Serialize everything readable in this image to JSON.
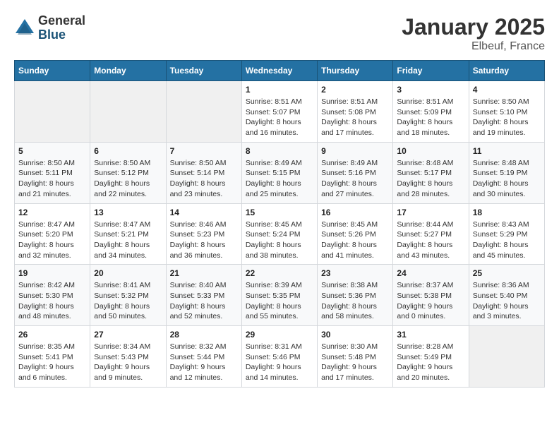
{
  "logo": {
    "general": "General",
    "blue": "Blue"
  },
  "title": "January 2025",
  "subtitle": "Elbeuf, France",
  "header_days": [
    "Sunday",
    "Monday",
    "Tuesday",
    "Wednesday",
    "Thursday",
    "Friday",
    "Saturday"
  ],
  "weeks": [
    [
      {
        "day": "",
        "info": ""
      },
      {
        "day": "",
        "info": ""
      },
      {
        "day": "",
        "info": ""
      },
      {
        "day": "1",
        "info": "Sunrise: 8:51 AM\nSunset: 5:07 PM\nDaylight: 8 hours\nand 16 minutes."
      },
      {
        "day": "2",
        "info": "Sunrise: 8:51 AM\nSunset: 5:08 PM\nDaylight: 8 hours\nand 17 minutes."
      },
      {
        "day": "3",
        "info": "Sunrise: 8:51 AM\nSunset: 5:09 PM\nDaylight: 8 hours\nand 18 minutes."
      },
      {
        "day": "4",
        "info": "Sunrise: 8:50 AM\nSunset: 5:10 PM\nDaylight: 8 hours\nand 19 minutes."
      }
    ],
    [
      {
        "day": "5",
        "info": "Sunrise: 8:50 AM\nSunset: 5:11 PM\nDaylight: 8 hours\nand 21 minutes."
      },
      {
        "day": "6",
        "info": "Sunrise: 8:50 AM\nSunset: 5:12 PM\nDaylight: 8 hours\nand 22 minutes."
      },
      {
        "day": "7",
        "info": "Sunrise: 8:50 AM\nSunset: 5:14 PM\nDaylight: 8 hours\nand 23 minutes."
      },
      {
        "day": "8",
        "info": "Sunrise: 8:49 AM\nSunset: 5:15 PM\nDaylight: 8 hours\nand 25 minutes."
      },
      {
        "day": "9",
        "info": "Sunrise: 8:49 AM\nSunset: 5:16 PM\nDaylight: 8 hours\nand 27 minutes."
      },
      {
        "day": "10",
        "info": "Sunrise: 8:48 AM\nSunset: 5:17 PM\nDaylight: 8 hours\nand 28 minutes."
      },
      {
        "day": "11",
        "info": "Sunrise: 8:48 AM\nSunset: 5:19 PM\nDaylight: 8 hours\nand 30 minutes."
      }
    ],
    [
      {
        "day": "12",
        "info": "Sunrise: 8:47 AM\nSunset: 5:20 PM\nDaylight: 8 hours\nand 32 minutes."
      },
      {
        "day": "13",
        "info": "Sunrise: 8:47 AM\nSunset: 5:21 PM\nDaylight: 8 hours\nand 34 minutes."
      },
      {
        "day": "14",
        "info": "Sunrise: 8:46 AM\nSunset: 5:23 PM\nDaylight: 8 hours\nand 36 minutes."
      },
      {
        "day": "15",
        "info": "Sunrise: 8:45 AM\nSunset: 5:24 PM\nDaylight: 8 hours\nand 38 minutes."
      },
      {
        "day": "16",
        "info": "Sunrise: 8:45 AM\nSunset: 5:26 PM\nDaylight: 8 hours\nand 41 minutes."
      },
      {
        "day": "17",
        "info": "Sunrise: 8:44 AM\nSunset: 5:27 PM\nDaylight: 8 hours\nand 43 minutes."
      },
      {
        "day": "18",
        "info": "Sunrise: 8:43 AM\nSunset: 5:29 PM\nDaylight: 8 hours\nand 45 minutes."
      }
    ],
    [
      {
        "day": "19",
        "info": "Sunrise: 8:42 AM\nSunset: 5:30 PM\nDaylight: 8 hours\nand 48 minutes."
      },
      {
        "day": "20",
        "info": "Sunrise: 8:41 AM\nSunset: 5:32 PM\nDaylight: 8 hours\nand 50 minutes."
      },
      {
        "day": "21",
        "info": "Sunrise: 8:40 AM\nSunset: 5:33 PM\nDaylight: 8 hours\nand 52 minutes."
      },
      {
        "day": "22",
        "info": "Sunrise: 8:39 AM\nSunset: 5:35 PM\nDaylight: 8 hours\nand 55 minutes."
      },
      {
        "day": "23",
        "info": "Sunrise: 8:38 AM\nSunset: 5:36 PM\nDaylight: 8 hours\nand 58 minutes."
      },
      {
        "day": "24",
        "info": "Sunrise: 8:37 AM\nSunset: 5:38 PM\nDaylight: 9 hours\nand 0 minutes."
      },
      {
        "day": "25",
        "info": "Sunrise: 8:36 AM\nSunset: 5:40 PM\nDaylight: 9 hours\nand 3 minutes."
      }
    ],
    [
      {
        "day": "26",
        "info": "Sunrise: 8:35 AM\nSunset: 5:41 PM\nDaylight: 9 hours\nand 6 minutes."
      },
      {
        "day": "27",
        "info": "Sunrise: 8:34 AM\nSunset: 5:43 PM\nDaylight: 9 hours\nand 9 minutes."
      },
      {
        "day": "28",
        "info": "Sunrise: 8:32 AM\nSunset: 5:44 PM\nDaylight: 9 hours\nand 12 minutes."
      },
      {
        "day": "29",
        "info": "Sunrise: 8:31 AM\nSunset: 5:46 PM\nDaylight: 9 hours\nand 14 minutes."
      },
      {
        "day": "30",
        "info": "Sunrise: 8:30 AM\nSunset: 5:48 PM\nDaylight: 9 hours\nand 17 minutes."
      },
      {
        "day": "31",
        "info": "Sunrise: 8:28 AM\nSunset: 5:49 PM\nDaylight: 9 hours\nand 20 minutes."
      },
      {
        "day": "",
        "info": ""
      }
    ]
  ]
}
